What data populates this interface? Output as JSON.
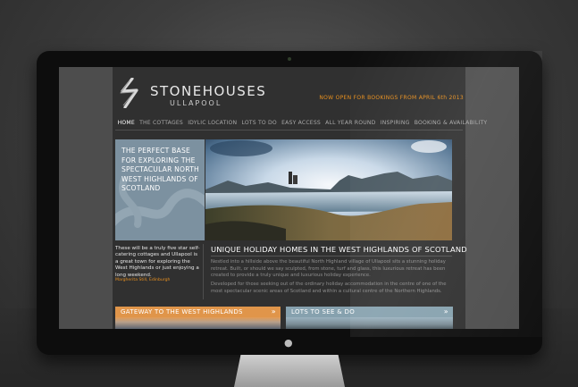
{
  "site": {
    "logo": {
      "name": "STONEHOUSES",
      "sub": "ULLAPOOL"
    },
    "announcement": "NOW OPEN FOR BOOKINGS FROM APRIL 6th 2013",
    "nav": [
      {
        "label": "HOME",
        "active": true
      },
      {
        "label": "THE COTTAGES"
      },
      {
        "label": "IDYLIC LOCATION"
      },
      {
        "label": "LOTS TO DO"
      },
      {
        "label": "EASY ACCESS"
      },
      {
        "label": "ALL YEAR ROUND"
      },
      {
        "label": "INSPIRING"
      },
      {
        "label": "BOOKING & AVAILABILITY"
      }
    ],
    "hero": {
      "text": "THE PERFECT BASE FOR EXPLORING THE SPECTACULAR NORTH WEST HIGHLANDS OF SCOTLAND"
    },
    "quote": {
      "text": "These will be a truly five star self-catering cottages and Ullapool is a great town for exploring the West Highlands or just enjoying a long weekend.",
      "author": "Margherita Still, Edinburgh"
    },
    "intro": {
      "heading": "UNIQUE HOLIDAY HOMES IN THE WEST HIGHLANDS OF SCOTLAND",
      "paragraph_1": "Nestled into a hillside above the beautiful North Highland village of Ullapool sits a stunning holiday retreat. Built, or should we say sculpted, from stone, turf and glass, this luxurious retreat has been created to provide a truly unique and luxurious holiday experience.",
      "paragraph_2": "Developed for those seeking out of the ordinary holiday accommodation in the centre of one of the most spectacular scenic areas of Scotland and within a cultural centre of the Northern Highlands."
    },
    "bands": [
      {
        "label": "GATEWAY TO THE WEST HIGHLANDS"
      },
      {
        "label": "LOTS TO SEE & DO"
      }
    ]
  },
  "colors": {
    "accent_orange": "#e8901f",
    "hero_panel": "#7c91a0",
    "band_orange": "#e0954a",
    "band_blue": "#86a1ae"
  },
  "icons": {
    "logo": "stonehouses-s-logo",
    "apple": "apple-logo",
    "chevron": "double-chevron-right-icon"
  }
}
